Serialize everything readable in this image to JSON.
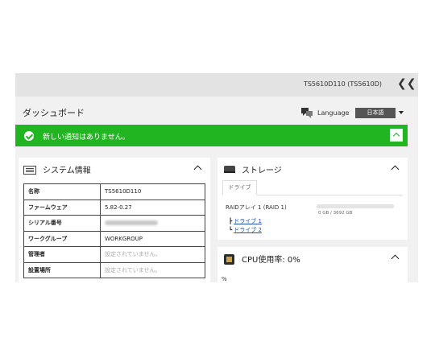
{
  "header": {
    "device_name": "TS5610D110 (TS5610D)",
    "collapse_symbol": "❮❮"
  },
  "dashboard": {
    "title": "ダッシュボード",
    "language_label": "Language",
    "language_value": "日本語"
  },
  "notice": {
    "text": "新しい通知はありません。"
  },
  "system_info": {
    "title": "システム情報",
    "rows": [
      {
        "key": "名称",
        "value": "TS5610D110"
      },
      {
        "key": "ファームウェア",
        "value": "5.82-0.27"
      },
      {
        "key": "シリアル番号",
        "value": ""
      },
      {
        "key": "ワークグループ",
        "value": "WORKGROUP"
      },
      {
        "key": "管理者",
        "value": "設定されていません。"
      },
      {
        "key": "設置場所",
        "value": "設定されていません。"
      }
    ]
  },
  "storage": {
    "title": "ストレージ",
    "tab_label": "ドライブ",
    "raid_label": "RAIDアレイ 1 (RAID 1)",
    "raid_usage_fraction": 0,
    "raid_size": "0 GB / 3692 GB",
    "drives": [
      {
        "prefix": "┣",
        "label": "ドライブ 1"
      },
      {
        "prefix": "┗",
        "label": "ドライブ 2"
      }
    ]
  },
  "cpu": {
    "title": "CPU使用率: 0%",
    "unit_label": "%"
  },
  "colors": {
    "notice_green": "#22b522",
    "link_blue": "#1a4fa6",
    "topbar_gray": "#e3e3e3"
  },
  "icons": [
    "check-icon",
    "chevron-up-icon",
    "double-chevron-left-icon",
    "language-icon",
    "system-info-icon",
    "disk-icon",
    "cpu-icon"
  ]
}
